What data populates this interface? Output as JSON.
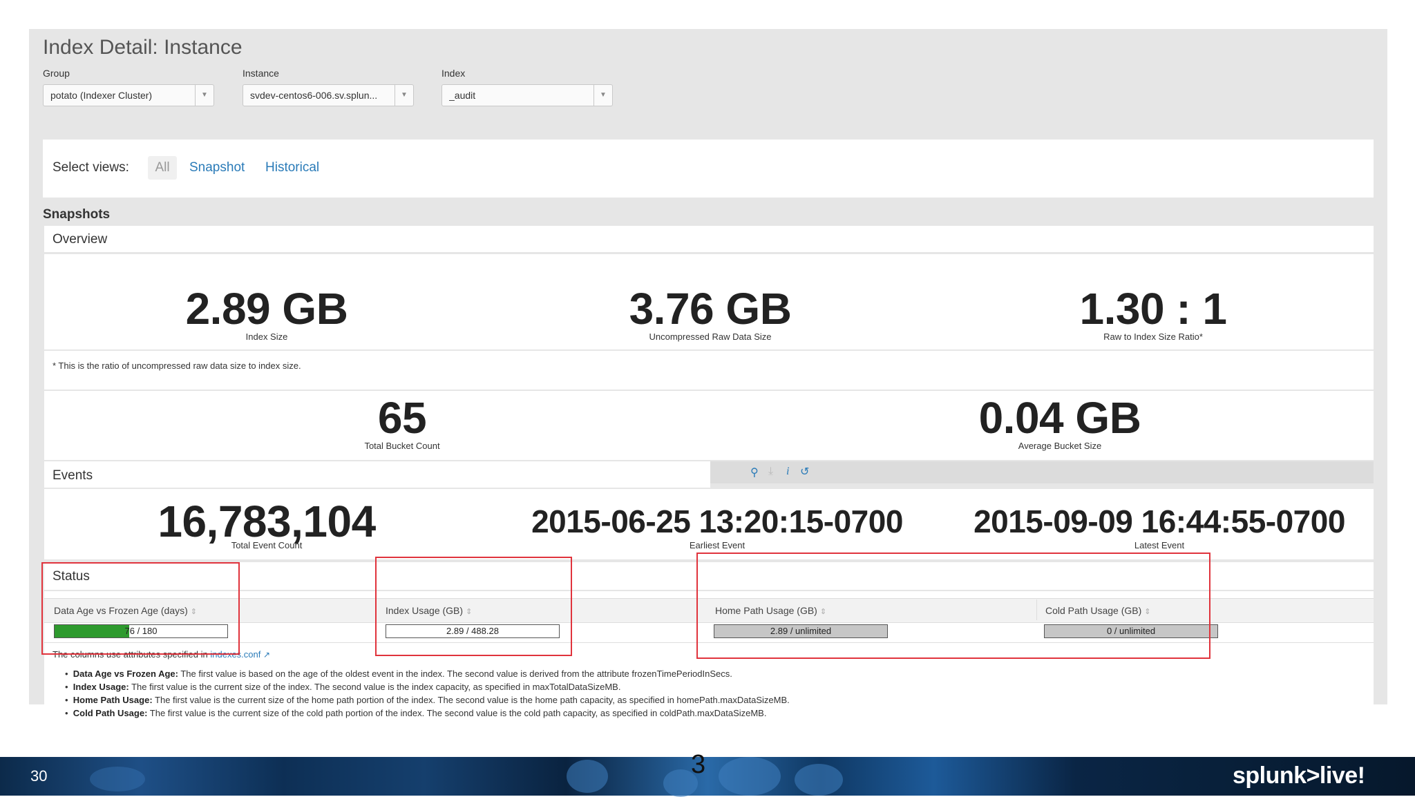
{
  "page": {
    "title": "Index Detail: Instance"
  },
  "filters": {
    "group": {
      "label": "Group",
      "value": "potato (Indexer Cluster)"
    },
    "instance": {
      "label": "Instance",
      "value": "svdev-centos6-006.sv.splun..."
    },
    "index": {
      "label": "Index",
      "value": "_audit"
    }
  },
  "views": {
    "label": "Select views:",
    "all": "All",
    "snapshot": "Snapshot",
    "historical": "Historical"
  },
  "snapshots": {
    "heading": "Snapshots",
    "overview": {
      "label": "Overview",
      "index_size": {
        "value": "2.89 GB",
        "caption": "Index Size"
      },
      "raw_size": {
        "value": "3.76 GB",
        "caption": "Uncompressed Raw Data Size"
      },
      "ratio": {
        "value": "1.30 : 1",
        "caption": "Raw to Index Size Ratio*"
      },
      "footnote": "* This is the ratio of uncompressed raw data size to index size.",
      "bucket_count": {
        "value": "65",
        "caption": "Total Bucket Count"
      },
      "avg_bucket": {
        "value": "0.04 GB",
        "caption": "Average Bucket Size"
      }
    },
    "events": {
      "label": "Events",
      "total": {
        "value": "16,783,104",
        "caption": "Total Event Count"
      },
      "earliest": {
        "value": "2015-06-25 13:20:15-0700",
        "caption": "Earliest Event"
      },
      "latest": {
        "value": "2015-09-09 16:44:55-0700",
        "caption": "Latest Event"
      }
    },
    "status": {
      "label": "Status",
      "columns": {
        "data_age": "Data Age vs Frozen Age (days)",
        "index_usage": "Index Usage (GB)",
        "home_path": "Home Path Usage (GB)",
        "cold_path": "Cold Path Usage (GB)"
      },
      "values": {
        "data_age": "76 / 180",
        "data_age_fill": 0.43,
        "index_usage": "2.89 / 488.28",
        "home_path": "2.89 / unlimited",
        "cold_path": "0 / unlimited"
      },
      "note_prefix": "The columns use attributes specified in",
      "note_link": "indexes.conf",
      "bullets": [
        {
          "term": "Data Age vs Frozen Age:",
          "text": "The first value is based on the age of the oldest event in the index. The second value is derived from the attribute frozenTimePeriodInSecs."
        },
        {
          "term": "Index Usage:",
          "text": "The first value is the current size of the index. The second value is the index capacity, as specified in maxTotalDataSizeMB."
        },
        {
          "term": "Home Path Usage:",
          "text": "The first value is the current size of the home path portion of the index. The second value is the home path capacity, as specified in homePath.maxDataSizeMB."
        },
        {
          "term": "Cold Path Usage:",
          "text": "The first value is the current size of the cold path portion of the index. The second value is the cold path capacity, as specified in coldPath.maxDataSizeMB."
        }
      ]
    }
  },
  "colors": {
    "accent_link": "#2a7bb8",
    "progress_green": "#2e9a2e",
    "highlight_red": "#e0333c"
  },
  "footer": {
    "slide_number": "30",
    "center_number": "3",
    "brand": "splunk>live!"
  }
}
